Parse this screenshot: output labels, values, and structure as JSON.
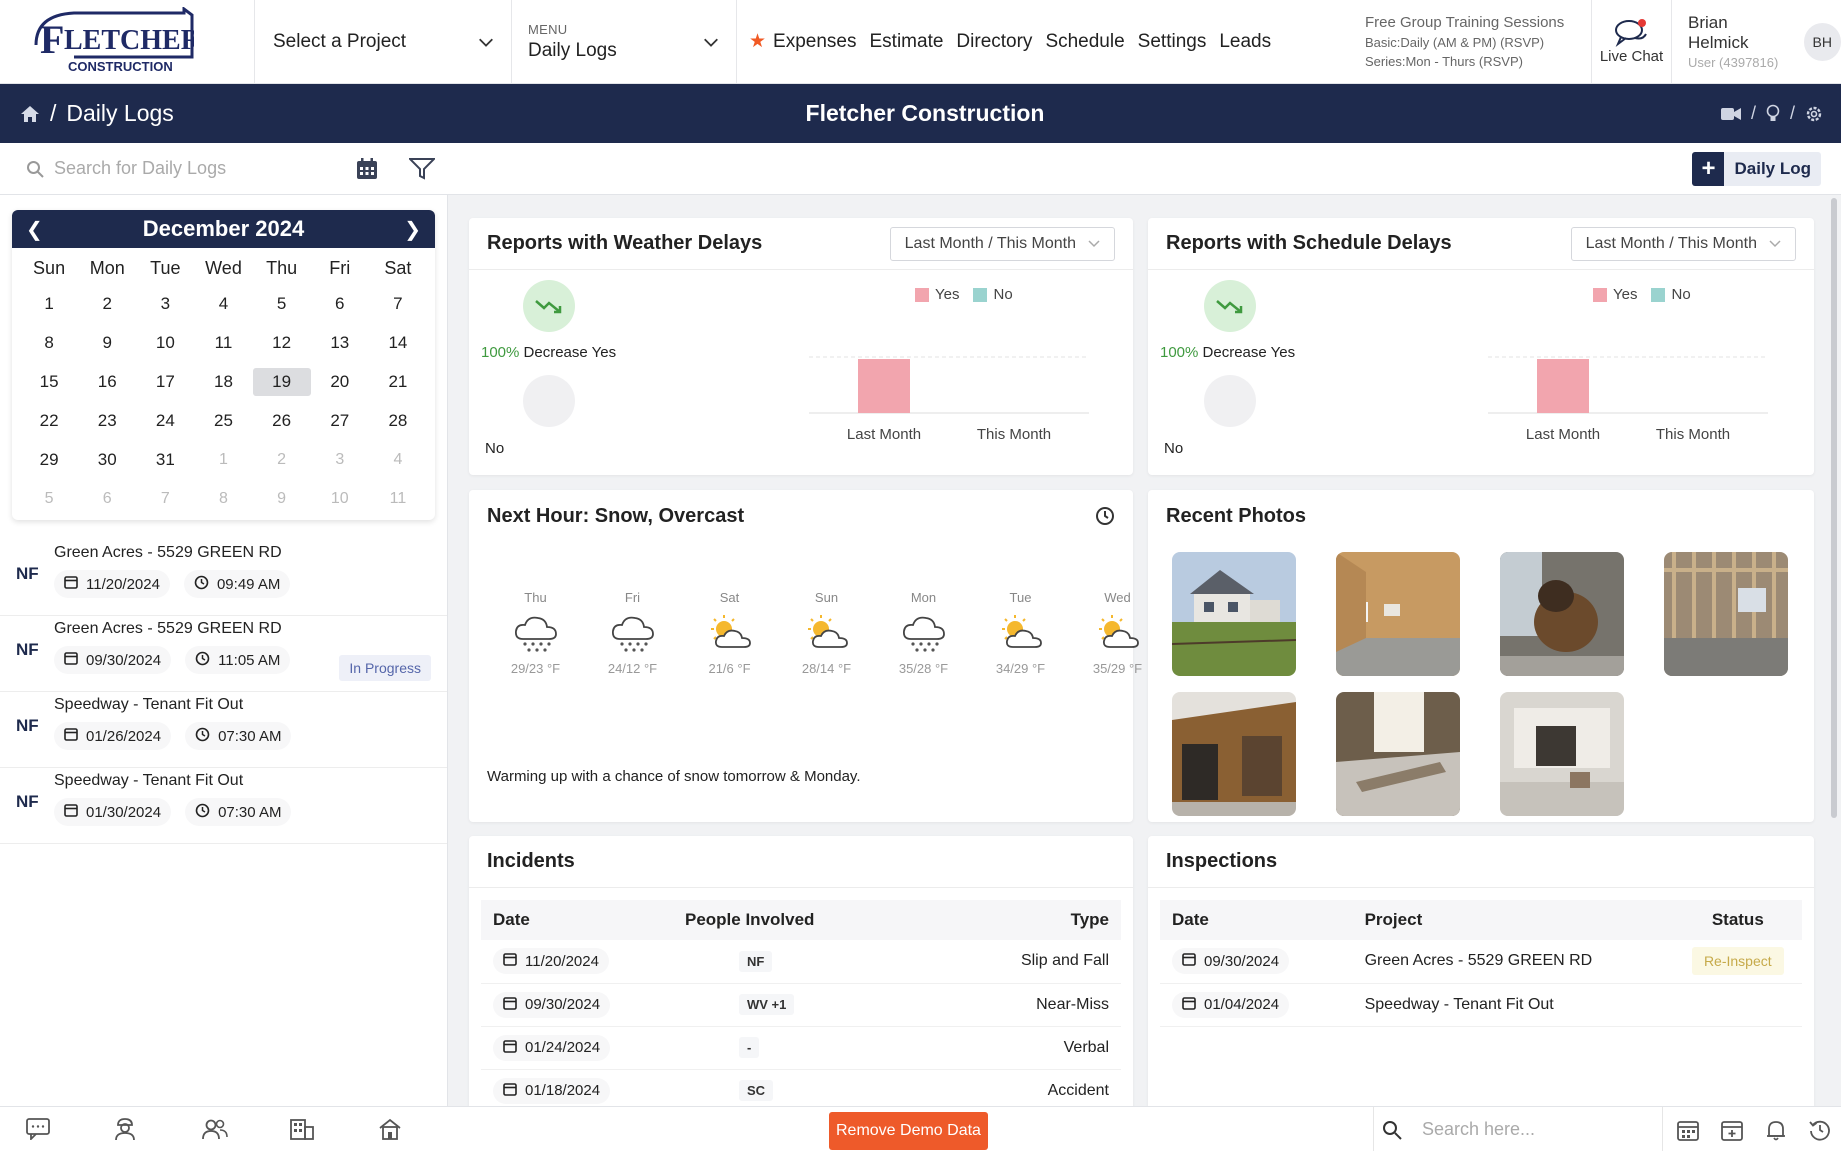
{
  "header": {
    "brand": "FLETCHER CONSTRUCTION",
    "project_select": "Select a Project",
    "menu_caption": "MENU",
    "menu_value": "Daily Logs",
    "nav": [
      "Expenses",
      "Estimate",
      "Directory",
      "Schedule",
      "Settings",
      "Leads"
    ],
    "training": {
      "title": "Free Group Training Sessions",
      "line1": "Basic:Daily (AM & PM) (RSVP)",
      "line2": "Series:Mon - Thurs (RSVP)"
    },
    "live_chat": "Live Chat",
    "user": {
      "name": "Brian Helmick",
      "sub": "User (4397816)",
      "initials": "BH"
    }
  },
  "titlebar": {
    "crumb_sep": "/",
    "crumb": "Daily Logs",
    "company": "Fletcher Construction"
  },
  "toolbar": {
    "search_placeholder": "Search for Daily Logs",
    "add_label": "Daily Log"
  },
  "calendar": {
    "month": "December 2024",
    "dow": [
      "Sun",
      "Mon",
      "Tue",
      "Wed",
      "Thu",
      "Fri",
      "Sat"
    ],
    "weeks": [
      [
        1,
        2,
        3,
        4,
        5,
        6,
        7
      ],
      [
        8,
        9,
        10,
        11,
        12,
        13,
        14
      ],
      [
        15,
        16,
        17,
        18,
        19,
        20,
        21
      ],
      [
        22,
        23,
        24,
        25,
        26,
        27,
        28
      ],
      [
        29,
        30,
        31,
        1,
        2,
        3,
        4
      ],
      [
        5,
        6,
        7,
        8,
        9,
        10,
        11
      ]
    ],
    "selected": 19
  },
  "logs": [
    {
      "initials": "NF",
      "title": "Green Acres - 5529 GREEN RD",
      "date": "11/20/2024",
      "time": "09:49 AM",
      "status": ""
    },
    {
      "initials": "NF",
      "title": "Green Acres - 5529 GREEN RD",
      "date": "09/30/2024",
      "time": "11:05 AM",
      "status": "In Progress"
    },
    {
      "initials": "NF",
      "title": "Speedway - Tenant Fit Out",
      "date": "01/26/2024",
      "time": "07:30 AM",
      "status": ""
    },
    {
      "initials": "NF",
      "title": "Speedway - Tenant Fit Out",
      "date": "01/30/2024",
      "time": "07:30 AM",
      "status": ""
    }
  ],
  "weather_delays": {
    "title": "Reports with Weather Delays",
    "range": "Last Month / This Month",
    "pct": "100%",
    "pct_text": "Decrease Yes",
    "no_label": "No",
    "legend_yes": "Yes",
    "legend_no": "No",
    "color_yes": "#f2a5ae",
    "color_no": "#9ad3cf"
  },
  "schedule_delays": {
    "title": "Reports with Schedule Delays",
    "range": "Last Month / This Month",
    "pct": "100%",
    "pct_text": "Decrease Yes",
    "no_label": "No",
    "legend_yes": "Yes",
    "legend_no": "No"
  },
  "chart_data": [
    {
      "type": "bar",
      "categories": [
        "Last Month",
        "This Month"
      ],
      "series": [
        {
          "name": "Yes",
          "values": [
            1,
            0
          ]
        },
        {
          "name": "No",
          "values": [
            0,
            0
          ]
        }
      ],
      "ylim": [
        0,
        1
      ]
    },
    {
      "type": "bar",
      "categories": [
        "Last Month",
        "This Month"
      ],
      "series": [
        {
          "name": "Yes",
          "values": [
            1,
            0
          ]
        },
        {
          "name": "No",
          "values": [
            0,
            0
          ]
        }
      ],
      "ylim": [
        0,
        1
      ]
    }
  ],
  "forecast": {
    "title": "Next Hour: Snow, Overcast",
    "summary": "Warming up with a chance of snow tomorrow & Monday.",
    "days": [
      {
        "name": "Thu",
        "icon": "snow",
        "temp": "29/23 °F"
      },
      {
        "name": "Fri",
        "icon": "snow",
        "temp": "24/12 °F"
      },
      {
        "name": "Sat",
        "icon": "partly-sunny",
        "temp": "21/6 °F"
      },
      {
        "name": "Sun",
        "icon": "partly-sunny",
        "temp": "28/14 °F"
      },
      {
        "name": "Mon",
        "icon": "snow",
        "temp": "35/28 °F"
      },
      {
        "name": "Tue",
        "icon": "partly-sunny",
        "temp": "34/29 °F"
      },
      {
        "name": "Wed",
        "icon": "partly-sunny",
        "temp": "35/29 °F"
      }
    ]
  },
  "photos": {
    "title": "Recent Photos",
    "count": 7
  },
  "incidents": {
    "title": "Incidents",
    "columns": [
      "Date",
      "People Involved",
      "Type"
    ],
    "rows": [
      {
        "date": "11/20/2024",
        "people": "NF",
        "type": "Slip and Fall"
      },
      {
        "date": "09/30/2024",
        "people": "WV +1",
        "type": "Near-Miss"
      },
      {
        "date": "01/24/2024",
        "people": "-",
        "type": "Verbal"
      },
      {
        "date": "01/18/2024",
        "people": "SC",
        "type": "Accident"
      }
    ]
  },
  "inspections": {
    "title": "Inspections",
    "columns": [
      "Date",
      "Project",
      "Status"
    ],
    "rows": [
      {
        "date": "09/30/2024",
        "project": "Green Acres - 5529 GREEN RD",
        "status": "Re-Inspect"
      },
      {
        "date": "01/04/2024",
        "project": "Speedway - Tenant Fit Out",
        "status": ""
      }
    ]
  },
  "bottom": {
    "remove_label": "Remove Demo Data",
    "search_placeholder": "Search here..."
  }
}
